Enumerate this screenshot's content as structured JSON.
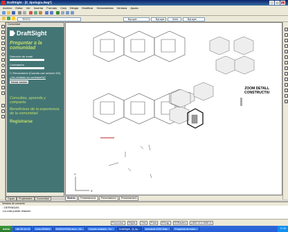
{
  "window": {
    "title": "DraftSight - [Il_tipologia.dwg*]"
  },
  "menu": [
    "Archivo",
    "Editar",
    "Ver",
    "Insertar",
    "Formato",
    "Cota",
    "Dibujar",
    "Modificar",
    "Herramientas",
    "Ventana",
    "Ayuda"
  ],
  "toolbar": {
    "layer_value": "TEXTO",
    "color_value": "ByLayer",
    "linetype_value": "ByLayer",
    "lineweight_value": "Solid line",
    "lineweight2_value": "ByLayer"
  },
  "panel": {
    "title": "Comunidad",
    "logo": "DraftSight",
    "heading": "Preguntar a la comunidad",
    "email_label": "Dirección de email",
    "password_label": "Contraseña",
    "remember": "Recordarme (Cuando use servicio DS)",
    "forgot": "¿Ha olvidado su contraseña?",
    "login_button": "Iniciar sesión",
    "tagline1": "Consultas, aprenda y comparta.",
    "tagline2": "Beneficiese de la experiencia de la comunidad.",
    "register": "Registrarse",
    "tabs": [
      "Capas",
      "Propiedades",
      "Comunidad"
    ]
  },
  "canvas": {
    "zoom_label_line1": "ZOOM DETALL",
    "zoom_label_line2": "CONSTRUCTIU"
  },
  "layout_tabs": [
    "Modelo",
    "Presentación1",
    "Presentación2",
    "Presentación3"
  ],
  "command": {
    "title": "Ventana de comando",
    "line1": ": DEFINIDAS",
    "line2": "La cota puede relación"
  },
  "status": [
    "Forzcursor",
    "Rejilla",
    "Orto",
    "Polar",
    "ESnap",
    "ESRastreo",
    "(1892.02,1/3480,0)"
  ],
  "taskbar": {
    "start": "Inicio",
    "items": [
      "dib 25-10-13",
      "Guía 3D/MAX",
      "ENGINYERIA deco - Mi...",
      "Horaris ordinaris - Ev...",
      "DraftSight - [Il_tip...",
      "Autodesk 123D Mak...",
      "Programa de mano..."
    ],
    "clock": "17:45"
  }
}
